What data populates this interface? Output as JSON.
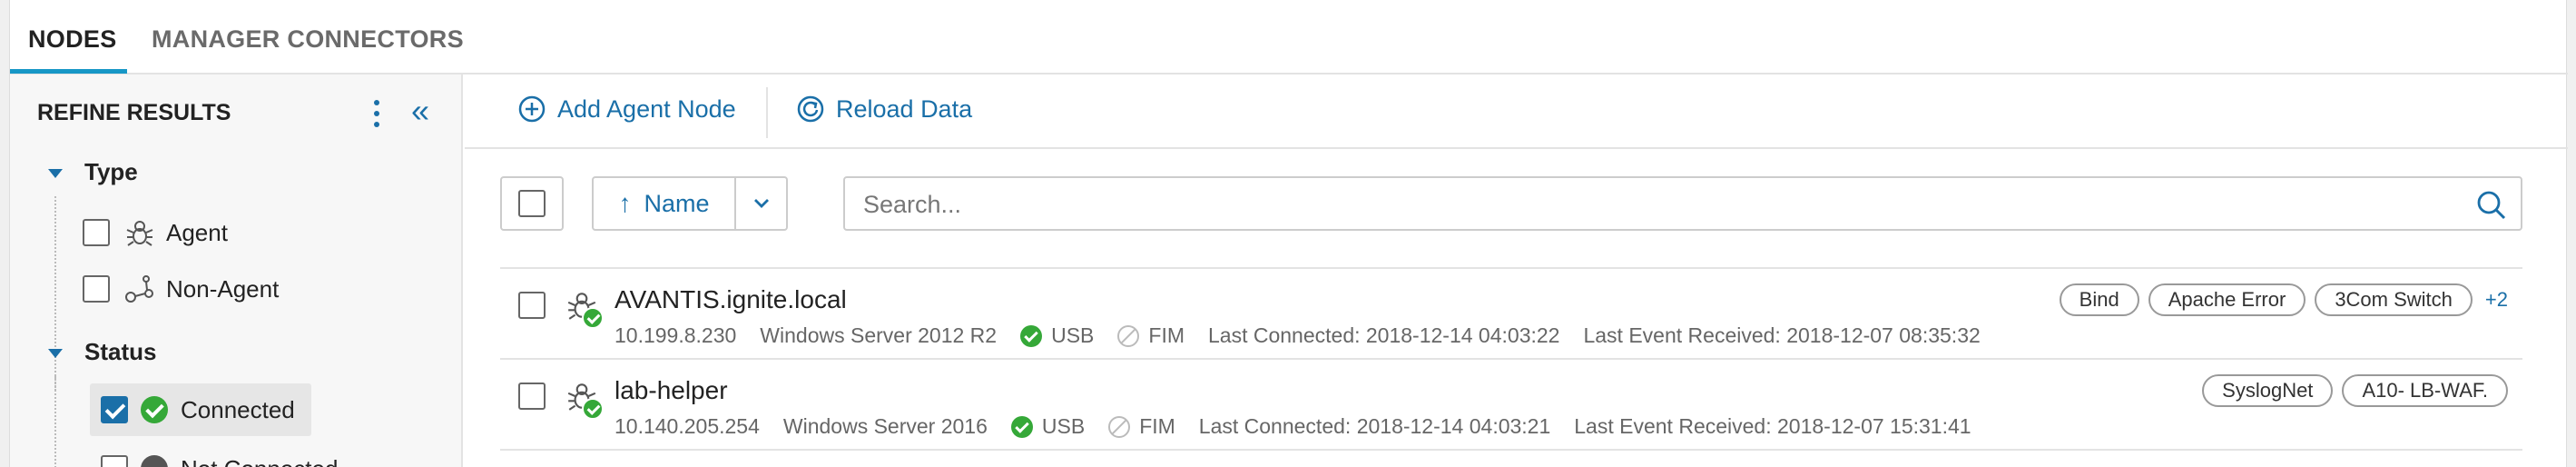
{
  "tabs": [
    {
      "label": "NODES",
      "active": true
    },
    {
      "label": "MANAGER CONNECTORS",
      "active": false
    }
  ],
  "sidebar": {
    "title": "REFINE RESULTS",
    "groups": [
      {
        "label": "Type",
        "items": [
          {
            "label": "Agent",
            "checked": false,
            "icon": "agent-icon"
          },
          {
            "label": "Non-Agent",
            "checked": false,
            "icon": "non-agent-icon"
          }
        ]
      },
      {
        "label": "Status",
        "items": [
          {
            "label": "Connected",
            "checked": true,
            "icon": "connected-icon"
          },
          {
            "label": "Not Connected",
            "checked": false,
            "icon": "not-connected-icon"
          }
        ]
      }
    ]
  },
  "toolbar": {
    "add_label": "Add Agent Node",
    "reload_label": "Reload Data"
  },
  "controls": {
    "sort_label": "Name",
    "sort_direction": "ascending",
    "search_placeholder": "Search..."
  },
  "nodes": [
    {
      "name": "AVANTIS.ignite.local",
      "ip": "10.199.8.230",
      "os": "Windows Server 2012 R2",
      "usb": "USB",
      "fim": "FIM",
      "last_connected": "Last Connected: 2018-12-14 04:03:22",
      "last_event": "Last Event Received: 2018-12-07 08:35:32",
      "tags": [
        "Bind",
        "Apache Error",
        "3Com Switch"
      ],
      "more": "+2"
    },
    {
      "name": "lab-helper",
      "ip": "10.140.205.254",
      "os": "Windows Server 2016",
      "usb": "USB",
      "fim": "FIM",
      "last_connected": "Last Connected: 2018-12-14 04:03:21",
      "last_event": "Last Event Received: 2018-12-07 15:31:41",
      "tags": [
        "SyslogNet",
        "A10- LB-WAF."
      ],
      "more": ""
    }
  ],
  "colors": {
    "accent": "#1a6fa8",
    "tab_underline": "#1797c6",
    "success": "#35a838"
  }
}
